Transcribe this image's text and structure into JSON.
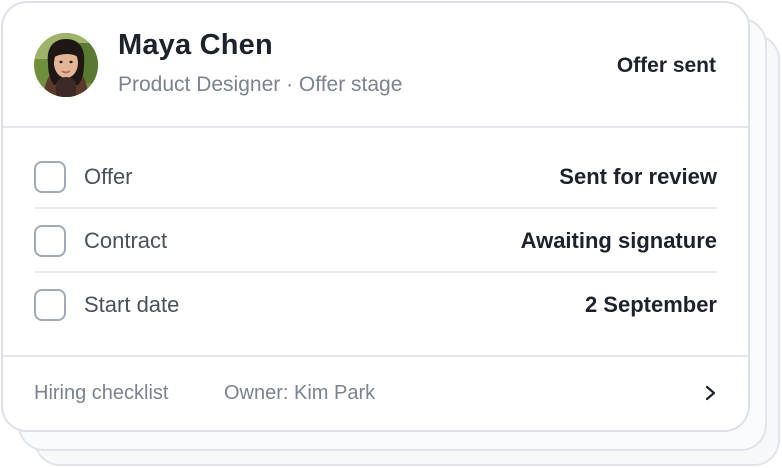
{
  "candidate": {
    "name": "Maya Chen",
    "subtitle": "Product Designer · Offer stage",
    "status": "Offer sent",
    "avatar": "avatar-photo"
  },
  "checklist": {
    "items": [
      {
        "label": "Offer",
        "value": "Sent for review",
        "checked": false
      },
      {
        "label": "Contract",
        "value": "Awaiting signature",
        "checked": false
      },
      {
        "label": "Start date",
        "value": "2 September",
        "checked": false
      }
    ]
  },
  "footer": {
    "title": "Hiring checklist",
    "owner": "Owner: Kim Park",
    "chevron_icon": "chevron-right-icon"
  },
  "colors": {
    "text_primary": "#1d222c",
    "text_secondary": "#7b8290",
    "border": "#e3e6eb"
  }
}
